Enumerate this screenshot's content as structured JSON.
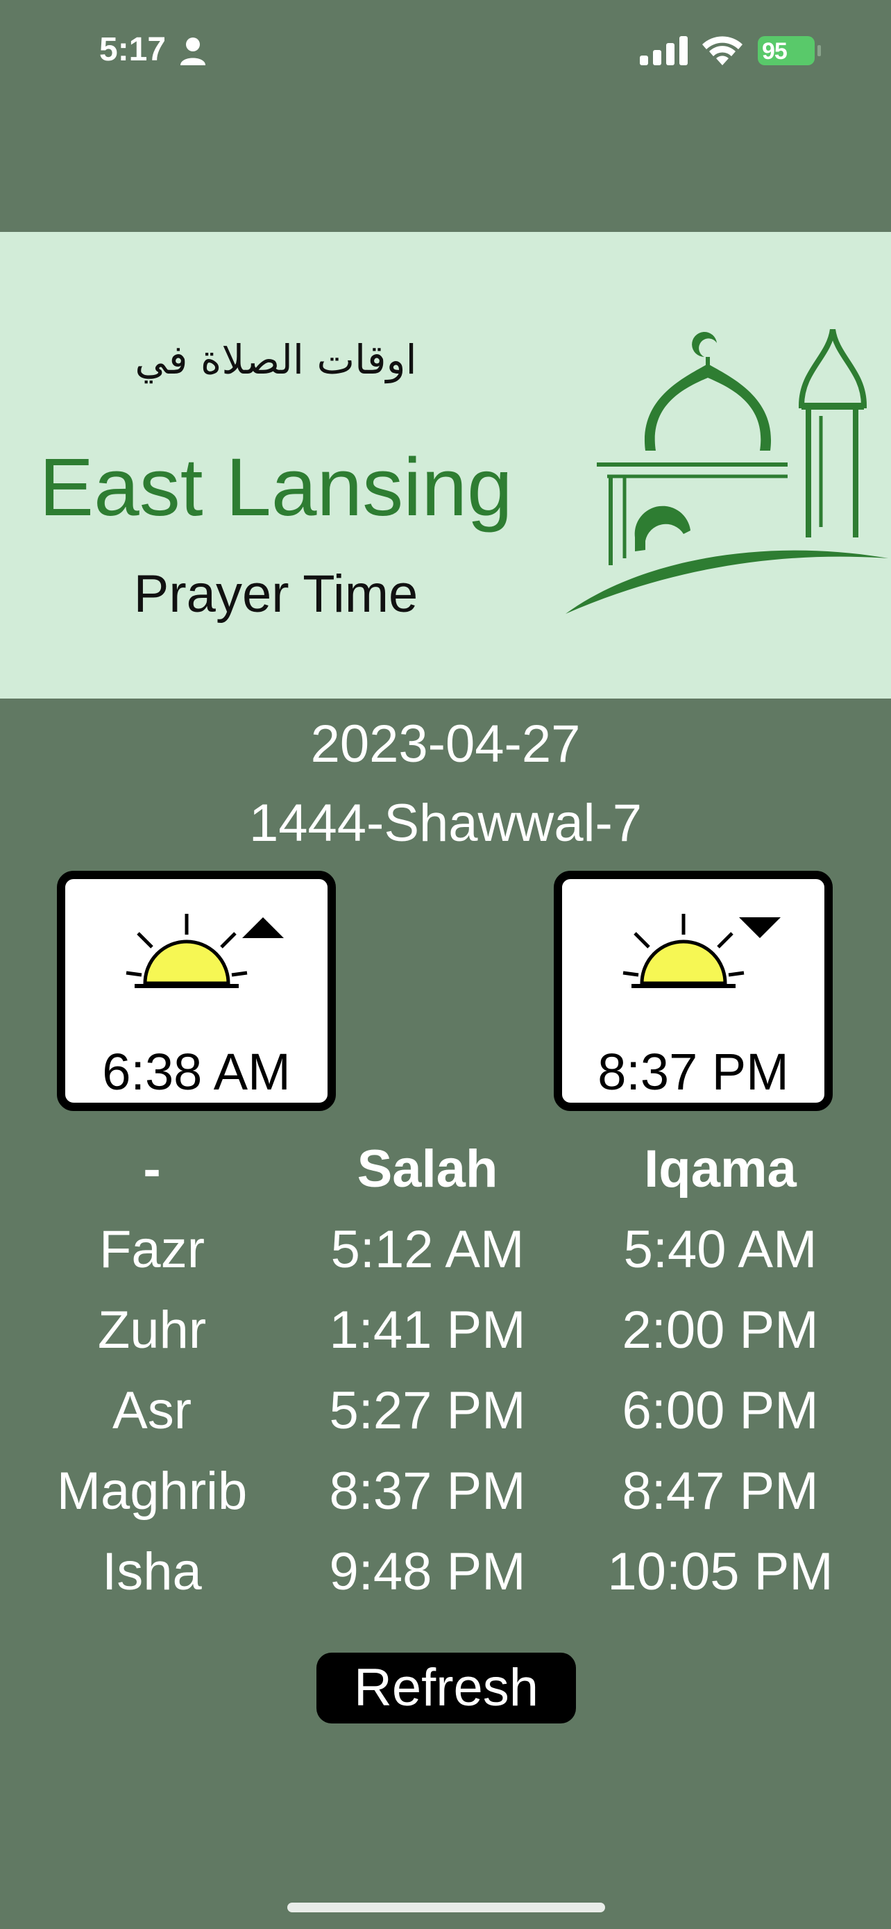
{
  "status_bar": {
    "time": "5:17",
    "battery": "95"
  },
  "banner": {
    "arabic_title": "اوقات الصلاة في",
    "city": "East Lansing",
    "subtitle": "Prayer Time"
  },
  "dates": {
    "gregorian": "2023-04-27",
    "hijri": "1444-Shawwal-7"
  },
  "sun": {
    "sunrise": "6:38 AM",
    "sunset": "8:37 PM"
  },
  "table": {
    "headers": [
      "-",
      "Salah",
      "Iqama"
    ],
    "rows": [
      {
        "name": "Fazr",
        "salah": "5:12 AM",
        "iqama": "5:40 AM"
      },
      {
        "name": "Zuhr",
        "salah": "1:41 PM",
        "iqama": "2:00 PM"
      },
      {
        "name": "Asr",
        "salah": "5:27 PM",
        "iqama": "6:00 PM"
      },
      {
        "name": "Maghrib",
        "salah": "8:37 PM",
        "iqama": "8:47 PM"
      },
      {
        "name": "Isha",
        "salah": "9:48 PM",
        "iqama": "10:05 PM"
      }
    ]
  },
  "refresh_label": "Refresh",
  "colors": {
    "background": "#617963",
    "banner": "#d2ecd8",
    "brand_green": "#2e7d32",
    "sun_yellow": "#f6f754",
    "battery_green": "#59c96a"
  }
}
